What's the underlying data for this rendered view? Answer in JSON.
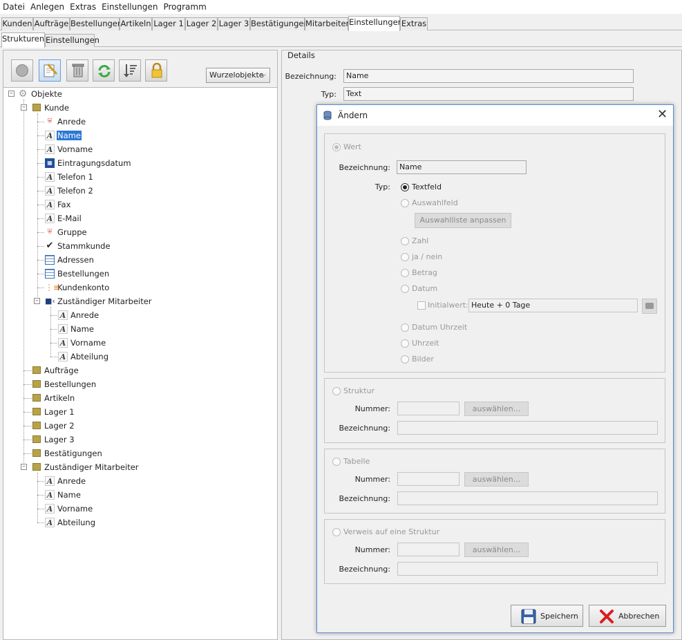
{
  "menu": [
    "Datei",
    "Anlegen",
    "Extras",
    "Einstellungen",
    "Programm"
  ],
  "top_tabs": [
    {
      "label": "Kunden",
      "selected": false
    },
    {
      "label": "Aufträge",
      "selected": false
    },
    {
      "label": "Bestellungen",
      "selected": false
    },
    {
      "label": "Artikeln",
      "selected": false
    },
    {
      "label": "Lager 1",
      "selected": false
    },
    {
      "label": "Lager 2",
      "selected": false
    },
    {
      "label": "Lager 3",
      "selected": false
    },
    {
      "label": "Bestätigungen",
      "selected": false
    },
    {
      "label": "Mitarbeiter",
      "selected": false
    },
    {
      "label": "Einstellungen",
      "selected": true
    },
    {
      "label": "Extras",
      "selected": false
    }
  ],
  "sub_tabs": [
    {
      "label": "Strukturen",
      "selected": true
    },
    {
      "label": "Einstellungen",
      "selected": false
    }
  ],
  "toolbar": {
    "root_dropdown": "Wurzelobjekte",
    "buttons": [
      "add-icon",
      "edit-icon",
      "trash-icon",
      "refresh-icon",
      "sort-icon",
      "lock-icon"
    ]
  },
  "tree": [
    {
      "label": "Objekte",
      "icon": "gear-icon",
      "level": 0
    },
    {
      "label": "Kunde",
      "icon": "folder-icon",
      "level": 1
    },
    {
      "label": "Anrede",
      "icon": "shield-icon",
      "level": 2
    },
    {
      "label": "Name",
      "icon": "text-field-icon",
      "level": 2,
      "selected": true
    },
    {
      "label": "Vorname",
      "icon": "text-field-icon",
      "level": 2
    },
    {
      "label": "Eintragungsdatum",
      "icon": "calendar-icon",
      "level": 2
    },
    {
      "label": "Telefon 1",
      "icon": "text-field-icon",
      "level": 2
    },
    {
      "label": "Telefon 2",
      "icon": "text-field-icon",
      "level": 2
    },
    {
      "label": "Fax",
      "icon": "text-field-icon",
      "level": 2
    },
    {
      "label": "E-Mail",
      "icon": "text-field-icon",
      "level": 2
    },
    {
      "label": "Gruppe",
      "icon": "shield-icon",
      "level": 2
    },
    {
      "label": "Stammkunde",
      "icon": "checkmark-icon",
      "level": 2
    },
    {
      "label": "Adressen",
      "icon": "table-icon",
      "level": 2
    },
    {
      "label": "Bestellungen",
      "icon": "table-icon",
      "level": 2
    },
    {
      "label": "Kundenkonto",
      "icon": "hierarchy-icon",
      "level": 2
    },
    {
      "label": "Zuständiger Mitarbeiter",
      "icon": "reference-icon",
      "level": 2
    },
    {
      "label": "Anrede",
      "icon": "text-field-icon",
      "level": 3
    },
    {
      "label": "Name",
      "icon": "text-field-icon",
      "level": 3
    },
    {
      "label": "Vorname",
      "icon": "text-field-icon",
      "level": 3
    },
    {
      "label": "Abteilung",
      "icon": "text-field-icon",
      "level": 3
    },
    {
      "label": "Aufträge",
      "icon": "folder-icon",
      "level": 1
    },
    {
      "label": "Bestellungen",
      "icon": "folder-icon",
      "level": 1
    },
    {
      "label": "Artikeln",
      "icon": "folder-icon",
      "level": 1
    },
    {
      "label": "Lager 1",
      "icon": "folder-icon",
      "level": 1
    },
    {
      "label": "Lager 2",
      "icon": "folder-icon",
      "level": 1
    },
    {
      "label": "Lager 3",
      "icon": "folder-icon",
      "level": 1
    },
    {
      "label": "Bestätigungen",
      "icon": "folder-icon",
      "level": 1
    },
    {
      "label": "Zuständiger Mitarbeiter",
      "icon": "folder-icon",
      "level": 1
    },
    {
      "label": "Anrede",
      "icon": "text-field-icon",
      "level": 2
    },
    {
      "label": "Name",
      "icon": "text-field-icon",
      "level": 2
    },
    {
      "label": "Vorname",
      "icon": "text-field-icon",
      "level": 2
    },
    {
      "label": "Abteilung",
      "icon": "text-field-icon",
      "level": 2
    }
  ],
  "details": {
    "title": "Details",
    "bezeichnung_label": "Bezeichnung:",
    "bezeichnung_value": "Name",
    "typ_label": "Typ:",
    "typ_value": "Text"
  },
  "dialog": {
    "title": "Ändern",
    "wert": {
      "label": "Wert",
      "bezeichnung_label": "Bezeichnung:",
      "bezeichnung_value": "Name",
      "typ_label": "Typ:",
      "options": [
        "Textfeld",
        "Auswahlfeld",
        "Zahl",
        "ja / nein",
        "Betrag",
        "Datum",
        "Datum Uhrzeit",
        "Uhrzeit",
        "Bilder"
      ],
      "selected_option": "Textfeld",
      "auswahlliste_button": "Auswahlliste anpassen",
      "initialwert_label": "Initialwert:",
      "initialwert_value": "Heute + 0 Tage"
    },
    "struktur": {
      "label": "Struktur",
      "nummer_label": "Nummer:",
      "bezeichnung_label": "Bezeichnung:",
      "select_button": "auswählen..."
    },
    "tabelle": {
      "label": "Tabelle",
      "nummer_label": "Nummer:",
      "bezeichnung_label": "Bezeichnung:",
      "select_button": "auswählen..."
    },
    "verweis": {
      "label": "Verweis auf eine Struktur",
      "nummer_label": "Nummer:",
      "bezeichnung_label": "Bezeichnung:",
      "select_button": "auswählen..."
    },
    "save_button": "Speichern",
    "cancel_button": "Abbrechen"
  }
}
